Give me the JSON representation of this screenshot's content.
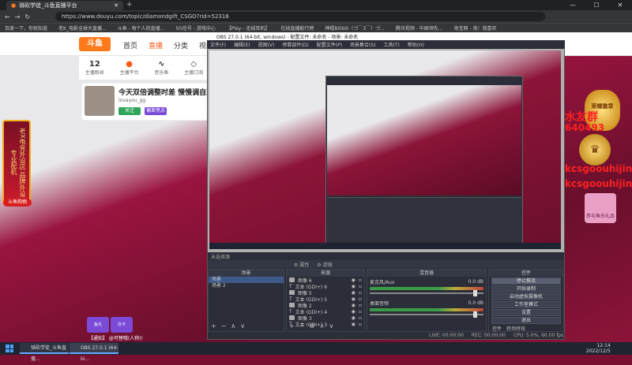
{
  "browser": {
    "tab_title": "骑砍学徒_斗鱼直播平台",
    "new_tab": "+",
    "url": "https://www.douyu.com/topic/diamondgift_CSGO?rid=52318",
    "window_controls": [
      "—",
      "☐",
      "✕"
    ],
    "bookmarks": [
      "百度一下，你就知道",
      "老K_电影全球大直播...",
      "斗鱼 - 每个人的直播...",
      "5G信号 - 游戏中心",
      "【Play - 无线耳机】",
      "在线直播能行榜",
      "神棍Bilibili（づ￣3￣）づ...",
      "腾讯视频 - 中国领先...",
      "淘宝网 - 淘！我喜欢"
    ]
  },
  "site": {
    "logo": "斗鱼",
    "nav": [
      "首页",
      "直播",
      "分类",
      "视频"
    ],
    "stats": [
      {
        "value": "12",
        "label": "主播粉丝"
      },
      {
        "value": "",
        "label": "主播平台"
      },
      {
        "value": "",
        "label": "音乐鱼"
      },
      {
        "value": "",
        "label": "主播订阅"
      }
    ],
    "room_title": "今天双倍调整时差 慢慢调自班",
    "room_host": "lovayou_gg",
    "follow_label": "关注",
    "report_label": "偏差亮点",
    "left_banner_text": "老X电竞外设店 品牌外设 专业配机",
    "left_banner_cta": "斗鱼购物",
    "bottom_gift_a": "鱼丸",
    "bottom_gift_b": "办卡",
    "notice": "【通知】 @可替哦(人称)!"
  },
  "overlay": {
    "name_a": "水友群",
    "number": "640493",
    "id_a": "kcsgoouhijin",
    "id_b": "kcsgoouhijin",
    "badge_right": "荣耀徽章",
    "crown": "♛",
    "gift_right": "参与鱼乐礼品"
  },
  "obs": {
    "title": "OBS 27.0.1 (64-bit, windows) - 配置文件: 未命名 - 场景: 未命名",
    "menu": [
      "文件(F)",
      "编辑(E)",
      "视图(V)",
      "停靠部件(D)",
      "配置文件(P)",
      "场景集合(S)",
      "工具(T)",
      "帮助(H)"
    ],
    "status_strip": "未选择源",
    "src_toolbar": [
      "⚙ 属性",
      "⚙ 滤镜"
    ],
    "panel_scenes": "场景",
    "panel_sources": "来源",
    "panel_mixer": "混音器",
    "panel_controls": "控件",
    "scenes": [
      "场景",
      "场景 2"
    ],
    "sources": [
      {
        "icon": "image",
        "label": "图像 6"
      },
      {
        "icon": "text",
        "label": "文本 (GDI+) 6"
      },
      {
        "icon": "image",
        "label": "图像 5"
      },
      {
        "icon": "text",
        "label": "文本 (GDI+) 5"
      },
      {
        "icon": "image",
        "label": "图像 2"
      },
      {
        "icon": "text",
        "label": "文本 (GDI+) 4"
      },
      {
        "icon": "image",
        "label": "图像 3"
      },
      {
        "icon": "text",
        "label": "文本 (GDI+) 3"
      }
    ],
    "mixer": [
      {
        "name": "麦克风/Aux",
        "db": "0.0 dB",
        "level": 0.7
      },
      {
        "name": "桌面音频",
        "db": "0.0 dB",
        "level": 0.65
      }
    ],
    "controls": [
      "停止推流",
      "开始录制",
      "启动虚拟摄像机",
      "工作室模式",
      "设置",
      "退出"
    ],
    "controls_tabs": [
      "控件",
      "转场特效"
    ],
    "statusbar": [
      "LIVE: 00:00:00",
      "REC: 00:00:00",
      "CPU: 5.0%, 60.00 fps"
    ]
  },
  "taskbar": {
    "browser_task": "骑砍学徒_斗鱼直播...",
    "obs_task": "OBS 27.0.1 (64-bi...",
    "time": "12:14",
    "date": "2022/12/5"
  },
  "colors": {
    "accent": "#ff5a1a",
    "page_red": "#8c1438",
    "obs_bg": "#2b2e38",
    "overlay_red": "#ff2020"
  }
}
